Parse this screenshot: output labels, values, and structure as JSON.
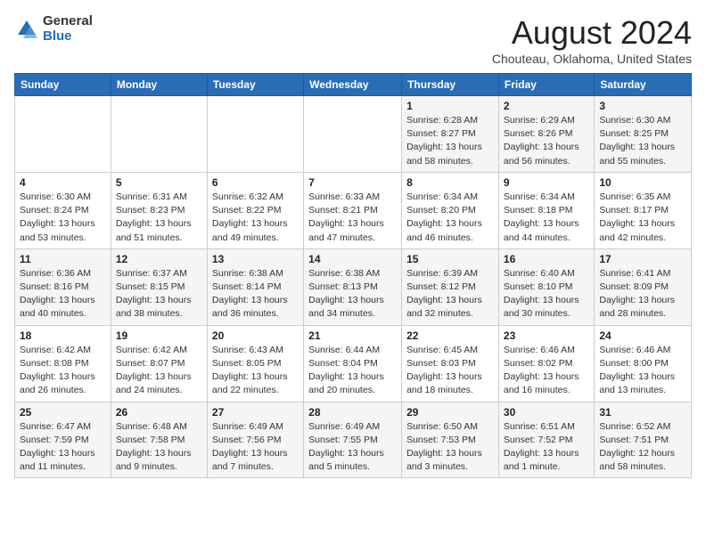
{
  "header": {
    "logo_general": "General",
    "logo_blue": "Blue",
    "month_title": "August 2024",
    "location": "Chouteau, Oklahoma, United States"
  },
  "days_of_week": [
    "Sunday",
    "Monday",
    "Tuesday",
    "Wednesday",
    "Thursday",
    "Friday",
    "Saturday"
  ],
  "weeks": [
    [
      {
        "day": "",
        "info": ""
      },
      {
        "day": "",
        "info": ""
      },
      {
        "day": "",
        "info": ""
      },
      {
        "day": "",
        "info": ""
      },
      {
        "day": "1",
        "info": "Sunrise: 6:28 AM\nSunset: 8:27 PM\nDaylight: 13 hours\nand 58 minutes."
      },
      {
        "day": "2",
        "info": "Sunrise: 6:29 AM\nSunset: 8:26 PM\nDaylight: 13 hours\nand 56 minutes."
      },
      {
        "day": "3",
        "info": "Sunrise: 6:30 AM\nSunset: 8:25 PM\nDaylight: 13 hours\nand 55 minutes."
      }
    ],
    [
      {
        "day": "4",
        "info": "Sunrise: 6:30 AM\nSunset: 8:24 PM\nDaylight: 13 hours\nand 53 minutes."
      },
      {
        "day": "5",
        "info": "Sunrise: 6:31 AM\nSunset: 8:23 PM\nDaylight: 13 hours\nand 51 minutes."
      },
      {
        "day": "6",
        "info": "Sunrise: 6:32 AM\nSunset: 8:22 PM\nDaylight: 13 hours\nand 49 minutes."
      },
      {
        "day": "7",
        "info": "Sunrise: 6:33 AM\nSunset: 8:21 PM\nDaylight: 13 hours\nand 47 minutes."
      },
      {
        "day": "8",
        "info": "Sunrise: 6:34 AM\nSunset: 8:20 PM\nDaylight: 13 hours\nand 46 minutes."
      },
      {
        "day": "9",
        "info": "Sunrise: 6:34 AM\nSunset: 8:18 PM\nDaylight: 13 hours\nand 44 minutes."
      },
      {
        "day": "10",
        "info": "Sunrise: 6:35 AM\nSunset: 8:17 PM\nDaylight: 13 hours\nand 42 minutes."
      }
    ],
    [
      {
        "day": "11",
        "info": "Sunrise: 6:36 AM\nSunset: 8:16 PM\nDaylight: 13 hours\nand 40 minutes."
      },
      {
        "day": "12",
        "info": "Sunrise: 6:37 AM\nSunset: 8:15 PM\nDaylight: 13 hours\nand 38 minutes."
      },
      {
        "day": "13",
        "info": "Sunrise: 6:38 AM\nSunset: 8:14 PM\nDaylight: 13 hours\nand 36 minutes."
      },
      {
        "day": "14",
        "info": "Sunrise: 6:38 AM\nSunset: 8:13 PM\nDaylight: 13 hours\nand 34 minutes."
      },
      {
        "day": "15",
        "info": "Sunrise: 6:39 AM\nSunset: 8:12 PM\nDaylight: 13 hours\nand 32 minutes."
      },
      {
        "day": "16",
        "info": "Sunrise: 6:40 AM\nSunset: 8:10 PM\nDaylight: 13 hours\nand 30 minutes."
      },
      {
        "day": "17",
        "info": "Sunrise: 6:41 AM\nSunset: 8:09 PM\nDaylight: 13 hours\nand 28 minutes."
      }
    ],
    [
      {
        "day": "18",
        "info": "Sunrise: 6:42 AM\nSunset: 8:08 PM\nDaylight: 13 hours\nand 26 minutes."
      },
      {
        "day": "19",
        "info": "Sunrise: 6:42 AM\nSunset: 8:07 PM\nDaylight: 13 hours\nand 24 minutes."
      },
      {
        "day": "20",
        "info": "Sunrise: 6:43 AM\nSunset: 8:05 PM\nDaylight: 13 hours\nand 22 minutes."
      },
      {
        "day": "21",
        "info": "Sunrise: 6:44 AM\nSunset: 8:04 PM\nDaylight: 13 hours\nand 20 minutes."
      },
      {
        "day": "22",
        "info": "Sunrise: 6:45 AM\nSunset: 8:03 PM\nDaylight: 13 hours\nand 18 minutes."
      },
      {
        "day": "23",
        "info": "Sunrise: 6:46 AM\nSunset: 8:02 PM\nDaylight: 13 hours\nand 16 minutes."
      },
      {
        "day": "24",
        "info": "Sunrise: 6:46 AM\nSunset: 8:00 PM\nDaylight: 13 hours\nand 13 minutes."
      }
    ],
    [
      {
        "day": "25",
        "info": "Sunrise: 6:47 AM\nSunset: 7:59 PM\nDaylight: 13 hours\nand 11 minutes."
      },
      {
        "day": "26",
        "info": "Sunrise: 6:48 AM\nSunset: 7:58 PM\nDaylight: 13 hours\nand 9 minutes."
      },
      {
        "day": "27",
        "info": "Sunrise: 6:49 AM\nSunset: 7:56 PM\nDaylight: 13 hours\nand 7 minutes."
      },
      {
        "day": "28",
        "info": "Sunrise: 6:49 AM\nSunset: 7:55 PM\nDaylight: 13 hours\nand 5 minutes."
      },
      {
        "day": "29",
        "info": "Sunrise: 6:50 AM\nSunset: 7:53 PM\nDaylight: 13 hours\nand 3 minutes."
      },
      {
        "day": "30",
        "info": "Sunrise: 6:51 AM\nSunset: 7:52 PM\nDaylight: 13 hours\nand 1 minute."
      },
      {
        "day": "31",
        "info": "Sunrise: 6:52 AM\nSunset: 7:51 PM\nDaylight: 12 hours\nand 58 minutes."
      }
    ]
  ]
}
